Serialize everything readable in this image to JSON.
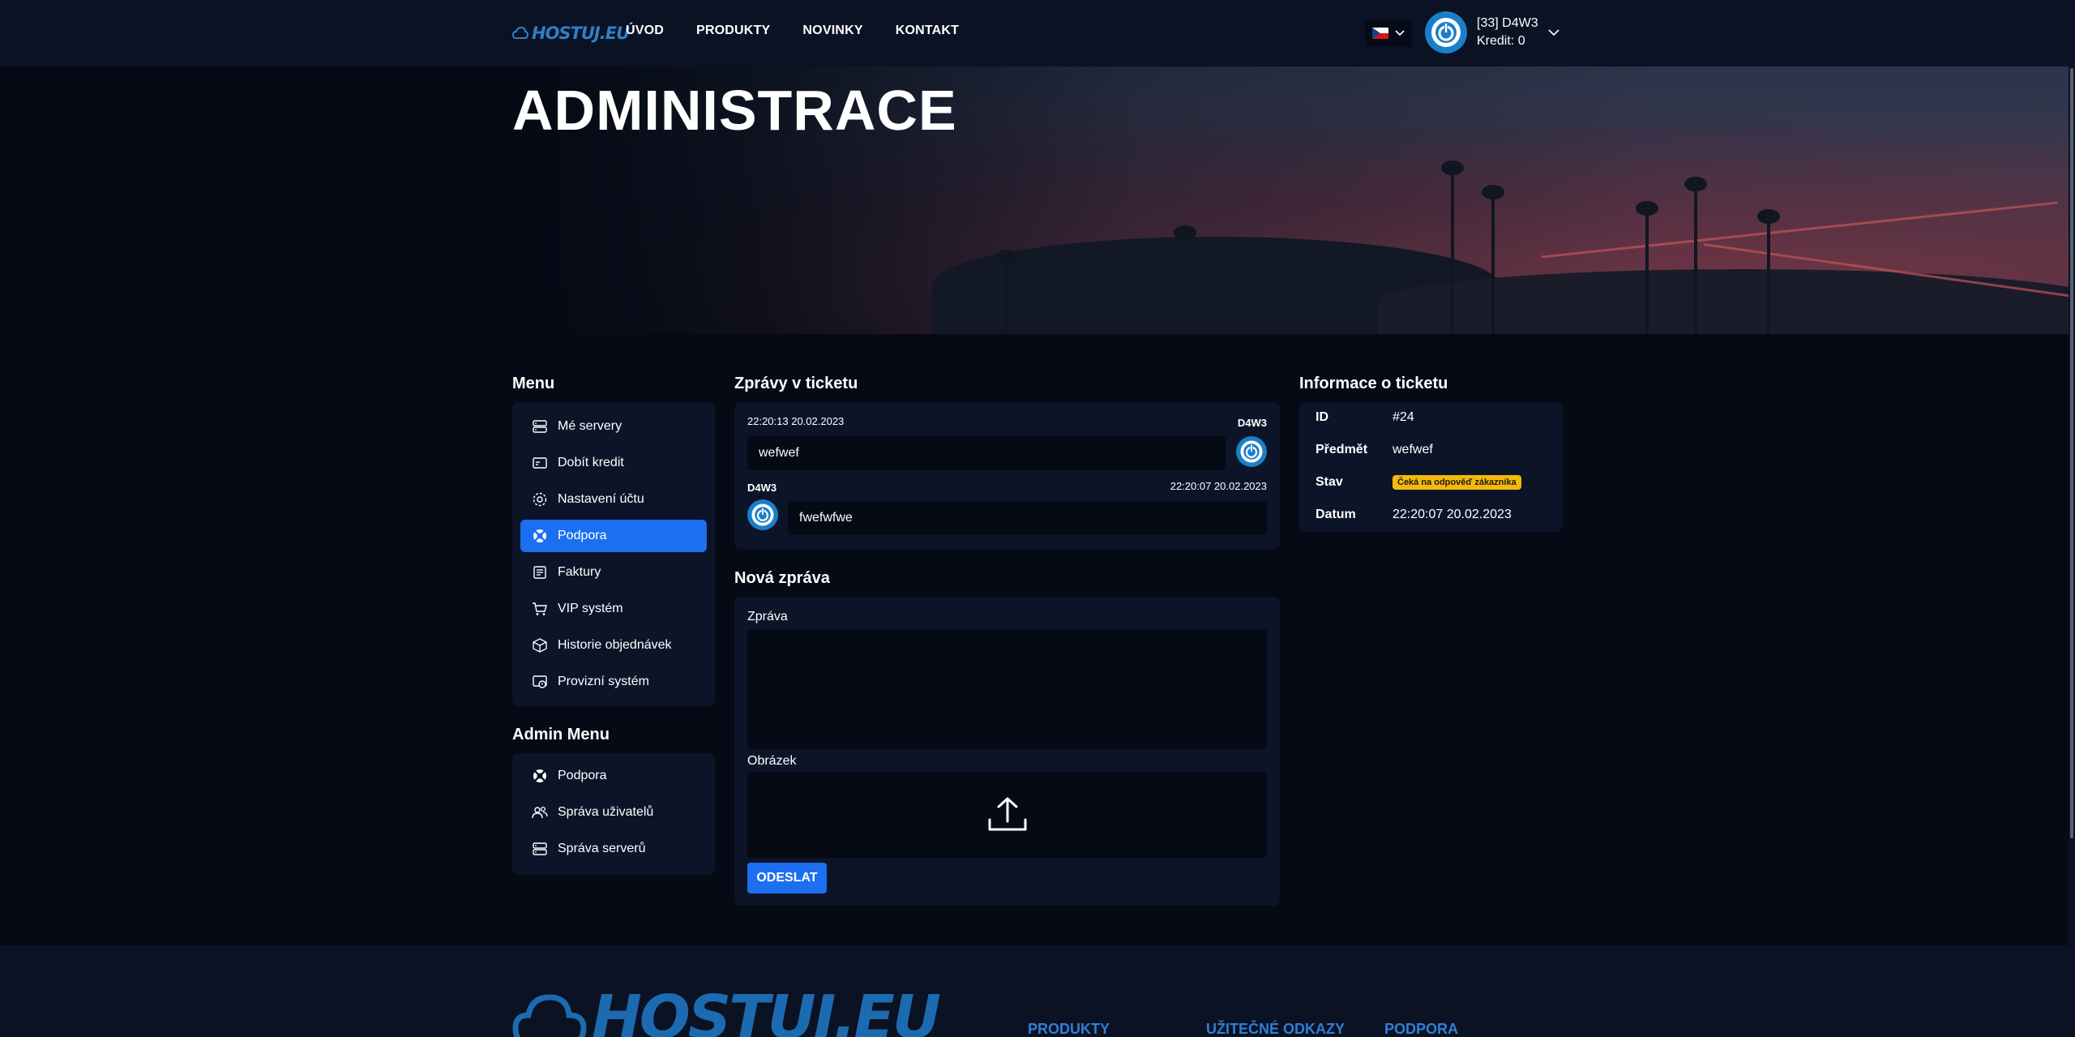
{
  "navbar": {
    "logo_text": "HOSTUJ.EU",
    "links": [
      "ÚVOD",
      "PRODUKTY",
      "NOVINKY",
      "KONTAKT"
    ],
    "user_name": "[33] D4W3",
    "user_credit": "Kredit: 0",
    "lang_icon": "czech-flag-icon"
  },
  "hero": {
    "title": "ADMINISTRACE"
  },
  "menu": {
    "title": "Menu",
    "items": [
      {
        "label": "Mé servery",
        "icon": "server-icon"
      },
      {
        "label": "Dobít kredit",
        "icon": "credit-card-icon"
      },
      {
        "label": "Nastavení účtu",
        "icon": "gear-icon"
      },
      {
        "label": "Podpora",
        "icon": "lifebuoy-icon"
      },
      {
        "label": "Faktury",
        "icon": "invoice-icon"
      },
      {
        "label": "VIP systém",
        "icon": "cart-icon"
      },
      {
        "label": "Historie objednávek",
        "icon": "box-icon"
      },
      {
        "label": "Provizní systém",
        "icon": "commission-icon"
      }
    ],
    "active_index": 3
  },
  "admin_menu": {
    "title": "Admin Menu",
    "items": [
      {
        "label": "Podpora",
        "icon": "lifebuoy-icon"
      },
      {
        "label": "Správa uživatelů",
        "icon": "users-icon"
      },
      {
        "label": "Správa serverů",
        "icon": "server-icon"
      }
    ]
  },
  "messages": {
    "title": "Zprávy v ticketu",
    "items": [
      {
        "time": "22:20:13 20.02.2023",
        "author": "D4W3",
        "text": "wefwef",
        "side": "right"
      },
      {
        "time": "22:20:07 20.02.2023",
        "author": "D4W3",
        "text": "fwefwfwe",
        "side": "left"
      }
    ]
  },
  "new_message": {
    "title": "Nová zpráva",
    "message_label": "Zpráva",
    "message_value": "",
    "image_label": "Obrázek",
    "send_label": "ODESLAT"
  },
  "ticket_info": {
    "title": "Informace o ticketu",
    "id_label": "ID",
    "id_value": "#24",
    "subject_label": "Předmět",
    "subject_value": "wefwef",
    "status_label": "Stav",
    "status_value": "Čeká na odpověď zákazníka",
    "status_color": "#f5b90b",
    "date_label": "Datum",
    "date_value": "22:20:07 20.02.2023"
  },
  "footer": {
    "logo_text": "HOSTUJ.EU",
    "columns": [
      "PRODUKTY",
      "UŽITEČNÉ ODKAZY",
      "PODPORA"
    ]
  },
  "colors": {
    "accent": "#1d6ff2",
    "background": "#050a15",
    "panel": "#0c1428",
    "navbar": "#0b1224"
  }
}
